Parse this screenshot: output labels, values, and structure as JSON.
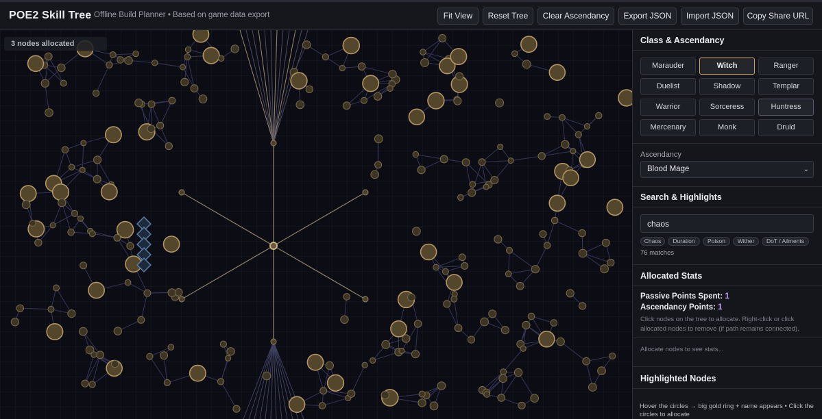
{
  "header": {
    "title": "POE2 Skill Tree",
    "subtitle": "Offline Build Planner • Based on game data export",
    "buttons": {
      "fit_view": "Fit View",
      "reset_tree": "Reset Tree",
      "clear_ascendancy": "Clear Ascendancy",
      "export_json": "Export JSON",
      "import_json": "Import JSON",
      "copy_share_url": "Copy Share URL"
    }
  },
  "tree": {
    "allocated_badge": "3 nodes allocated",
    "allocated_nodes": 3
  },
  "panel": {
    "class_section": {
      "title": "Class & Ascendancy",
      "classes": [
        {
          "label": "Marauder",
          "state": "normal"
        },
        {
          "label": "Witch",
          "state": "selected"
        },
        {
          "label": "Ranger",
          "state": "normal"
        },
        {
          "label": "Duelist",
          "state": "normal"
        },
        {
          "label": "Shadow",
          "state": "normal"
        },
        {
          "label": "Templar",
          "state": "normal"
        },
        {
          "label": "Warrior",
          "state": "normal"
        },
        {
          "label": "Sorceress",
          "state": "normal"
        },
        {
          "label": "Huntress",
          "state": "outlined"
        },
        {
          "label": "Mercenary",
          "state": "normal"
        },
        {
          "label": "Monk",
          "state": "normal"
        },
        {
          "label": "Druid",
          "state": "normal"
        }
      ],
      "ascendancy_label": "Ascendancy",
      "ascendancy_value": "Blood Mage"
    },
    "search_section": {
      "title": "Search & Highlights",
      "query": "chaos",
      "chips": [
        "Chaos",
        "Duration",
        "Poison",
        "Wither",
        "DoT / Ailments"
      ],
      "matches": "76 matches"
    },
    "stats_section": {
      "title": "Allocated Stats",
      "passive_label": "Passive Points Spent:",
      "passive_value": "1",
      "asc_label": "Ascendancy Points:",
      "asc_value": "1",
      "help": "Click nodes on the tree to allocate. Right-click or click allocated nodes to remove (if path remains connected).",
      "empty": "Allocate nodes to see stats..."
    },
    "highlighted_section": {
      "title": "Highlighted Nodes",
      "hint": "Hover the circles → big gold ring + name appears • Click the circles to allocate"
    }
  },
  "colors": {
    "accent_gold": "#c9a06a",
    "node_fill": "#4a3d26",
    "node_stroke": "#a08656",
    "edge": "#4a4b6a",
    "allocated_blue": "#4f6f95",
    "points_purple": "#c9a6f0"
  }
}
